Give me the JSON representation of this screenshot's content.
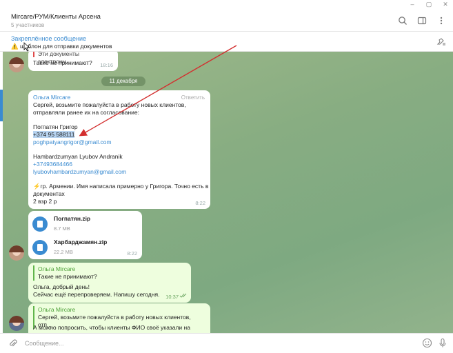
{
  "window": {
    "minimize": "–",
    "restore": "▢",
    "close": "✕"
  },
  "header": {
    "title": "Mircare/РУМ/Клиенты Арсена",
    "subtitle": "5 участников"
  },
  "pinned": {
    "title": "Закреплённое сообщение",
    "text": "⚠️ шаблон для отправки документов"
  },
  "messages": {
    "m1": {
      "quote": "Эти документы электронн...",
      "text": "Такие не принимают?",
      "time": "18:16"
    },
    "date": "11 декабря",
    "m2": {
      "sender": "Ольга Mircare",
      "reply_label": "Ответить",
      "l1": "Сергей, возьмите пожалуйста в работу новых клиентов,",
      "l2": "отправляли ранее их на согласование:",
      "l3": "Погпатян Григор",
      "l4": "+374 95 588111",
      "l5": "poghpatyangrigor@gmail.com",
      "l6": "Hambardzumyan Lyubov Andranik",
      "l7": "+37493684466",
      "l8": "lyubovhambardzumyan@gmail.com",
      "l9": "⚡гр. Армении. Имя написала примерно у Григора. Точно есть в",
      "l10": "документах",
      "l11": "2 взр 2 р",
      "time": "8:22"
    },
    "files": {
      "f1": {
        "name": "Погпатян.zip",
        "size": "8.7 MB"
      },
      "f2": {
        "name": "Харбарджамян.zip",
        "size": "22.2 MB"
      },
      "time": "8:22"
    },
    "m3": {
      "quote_sender": "Ольга Mircare",
      "quote_text": "Такие не принимают?",
      "l1": "Ольга, добрый день!",
      "l2": "Сейчас ещё перепроверяем. Напишу сегодня.",
      "time": "10:37"
    },
    "m4": {
      "quote_sender": "Ольга Mircare",
      "quote_text": "Сергей, возьмите пожалуйста в работу новых клиентов, отп...",
      "l1": "А можно попросить, чтобы клиенты ФИО своё указали на"
    }
  },
  "composer": {
    "placeholder": "Сообщение..."
  },
  "colors": {
    "accent": "#3a8bd1",
    "arrow": "#d32f2f",
    "outgoing": "#eefede"
  }
}
